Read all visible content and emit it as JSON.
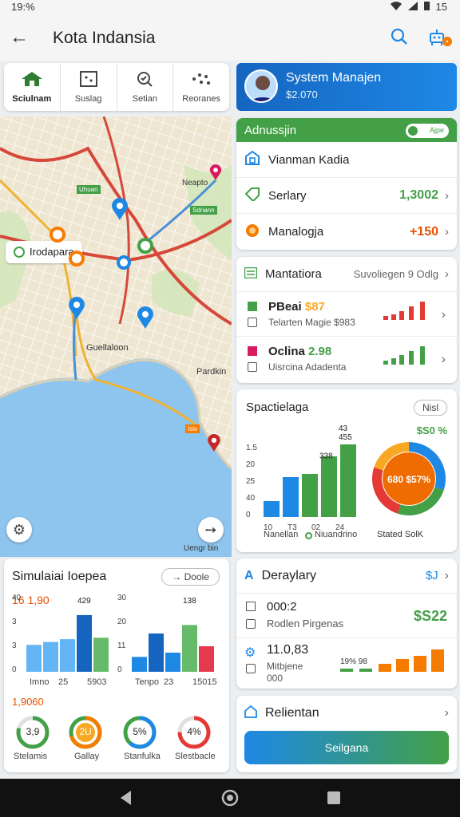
{
  "status": {
    "time": "19:%",
    "right": "15"
  },
  "appbar": {
    "title": "Kota Indansia"
  },
  "tabs": [
    {
      "label": "Sciulnam",
      "icon": "house-icon"
    },
    {
      "label": "Suslag",
      "icon": "grid-icon"
    },
    {
      "label": "Setian",
      "icon": "search-check-icon"
    },
    {
      "label": "Reoranes",
      "icon": "dots-icon"
    }
  ],
  "profile": {
    "name": "System Manajen",
    "value": "$2.070"
  },
  "map": {
    "chip": "Irodapara",
    "labels": [
      "Neapto",
      "Uhuan",
      "Sdriann",
      "Guellaloon",
      "Pardkin",
      "Isls",
      "Uengr bin"
    ]
  },
  "admission": {
    "title": "Adnussjin",
    "toggle": "Ajpe",
    "rows": [
      {
        "label": "Vianman Kadia",
        "value": ""
      },
      {
        "label": "Serlary",
        "value": "1,3002"
      },
      {
        "label": "Manalogja",
        "value": "+150"
      }
    ]
  },
  "mantatiora": {
    "title": "Mantatiora",
    "link": "Suvoliegen 9 Odlg",
    "items": [
      {
        "title": "PBeai",
        "amount": "$87",
        "sub": "Telarten Magie $983"
      },
      {
        "title": "Oclina",
        "amount": "2.98",
        "sub": "Uisrcina Adadenta"
      }
    ]
  },
  "spectielaga": {
    "title": "Spactielaga",
    "button": "Nisl",
    "donut_title": "$S0 %",
    "donut_center": "680 $57%",
    "donut_label": "Stated SolK",
    "legend": [
      "Nanellan",
      "Niuandrino"
    ]
  },
  "simulasi": {
    "title": "Simulaiai Ioepea",
    "button": "Doole",
    "value1": "16 1,90",
    "value2": "1,9060",
    "gauges": [
      {
        "label": "Stelamis",
        "value": "3,9"
      },
      {
        "label": "Gallay",
        "value": "2U"
      },
      {
        "label": "Stanfulka",
        "value": "5%"
      },
      {
        "label": "Slestbacle",
        "value": "4%"
      }
    ]
  },
  "deraylary": {
    "title": "Deraylary",
    "value": "$J",
    "rows": [
      {
        "a": "000:2",
        "b": "Rodlen Pirgenas",
        "value": "$S22"
      },
      {
        "a": "11.0,83",
        "b": "Mitbjene",
        "c": "000",
        "d": "19% 98"
      }
    ]
  },
  "relientan": {
    "title": "Relientan",
    "button": "Seilgana"
  },
  "chart_data": [
    {
      "type": "bar",
      "title": "",
      "categories": [
        "10",
        "T3",
        "02",
        "24"
      ],
      "values": [
        10,
        20,
        33.8,
        45.5
      ],
      "data_labels": [
        "",
        "",
        "338",
        "455"
      ],
      "top_label": "43",
      "y_ticks": [
        "1.5",
        "20",
        "25",
        "40",
        "0"
      ],
      "ylim": [
        0,
        50
      ]
    },
    {
      "type": "bar",
      "categories": [
        "Imno",
        "25",
        "5903"
      ],
      "series": [
        {
          "values": [
            19,
            21,
            23,
            40,
            24
          ]
        }
      ],
      "data_label": "429",
      "y_ticks": [
        "40",
        "3",
        "3",
        "0"
      ],
      "ylim": [
        0,
        45
      ]
    },
    {
      "type": "bar",
      "categories": [
        "Tenpo",
        "23",
        "15015"
      ],
      "series": [
        {
          "values": [
            7,
            18,
            9,
            22,
            12
          ]
        }
      ],
      "data_label": "138",
      "y_ticks": [
        "30",
        "20",
        "11",
        "0"
      ],
      "ylim": [
        0,
        30
      ]
    },
    {
      "type": "pie",
      "values": [
        30,
        25,
        25,
        20
      ]
    }
  ]
}
